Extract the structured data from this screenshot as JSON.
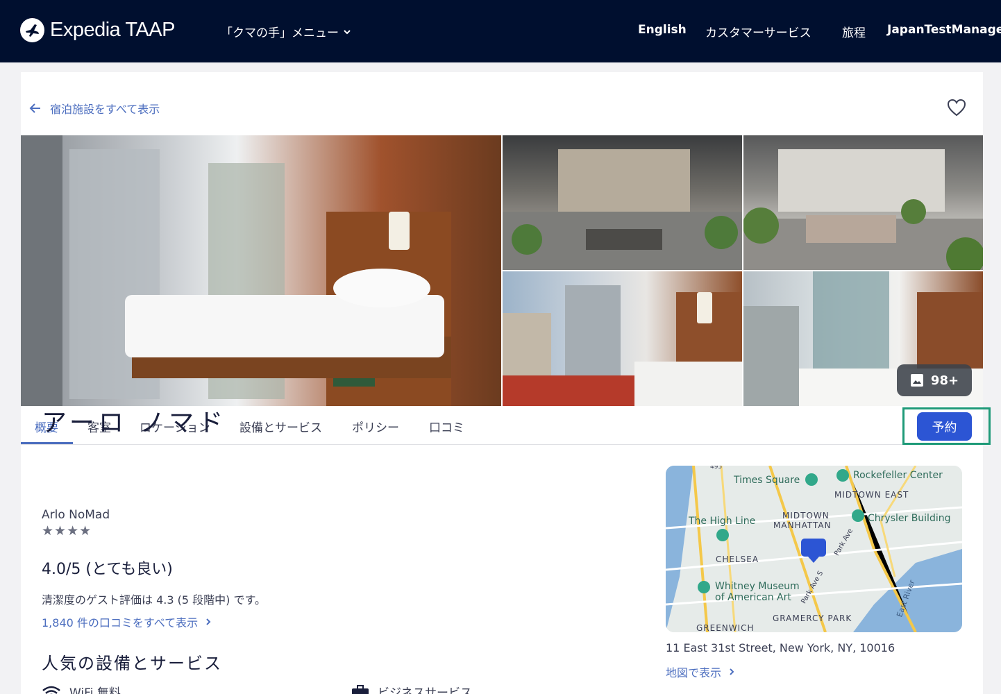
{
  "header": {
    "logo_text": "Expedia TAAP",
    "menu_label": "「クマの手」メニュー",
    "nav": [
      "English",
      "カスタマーサービス",
      "旅程",
      "JapanTestManager"
    ]
  },
  "back_link": "宿泊施設をすべて表示",
  "gallery": {
    "photo_count": "98+"
  },
  "tabs": [
    "概要",
    "客室",
    "ロケーション",
    "設備とサービス",
    "ポリシー",
    "口コミ"
  ],
  "book_button": "予約",
  "hotel": {
    "name_jp": "アーロ ノマド",
    "name_en": "Arlo NoMad",
    "stars": "★★★★",
    "rating": "4.0/5 (とても良い)",
    "cleanliness": "清潔度のゲスト評価は 4.3 (5 段階中) です。",
    "reviews_link": "1,840 件の口コミをすべて表示"
  },
  "amenities": {
    "heading": "人気の設備とサービス",
    "items": [
      "WiFi 無料",
      "ビジネスサービス"
    ]
  },
  "map": {
    "labels": {
      "times_square": "Times Square",
      "rockefeller": "Rockefeller Center",
      "midtown_east": "MIDTOWN EAST",
      "high_line": "The High Line",
      "midtown_manhattan_1": "MIDTOWN",
      "midtown_manhattan_2": "MANHATTAN",
      "chrysler": "Chrysler Building",
      "chelsea": "CHELSEA",
      "whitney_1": "Whitney Museum",
      "whitney_2": "of American Art",
      "gramercy": "GRAMERCY PARK",
      "greenwich": "GREENWICH",
      "east_river": "East River",
      "park_ave": "Park Ave",
      "park_ave_s": "Park Ave S",
      "route_495": "495"
    },
    "address": "11 East 31st Street, New York, NY, 10016",
    "view_link": "地図で表示"
  },
  "colors": {
    "header_bg": "#000f2f",
    "link": "#4c6ebf",
    "book_button": "#2c55d4",
    "highlight_frame": "#1e9a78"
  }
}
